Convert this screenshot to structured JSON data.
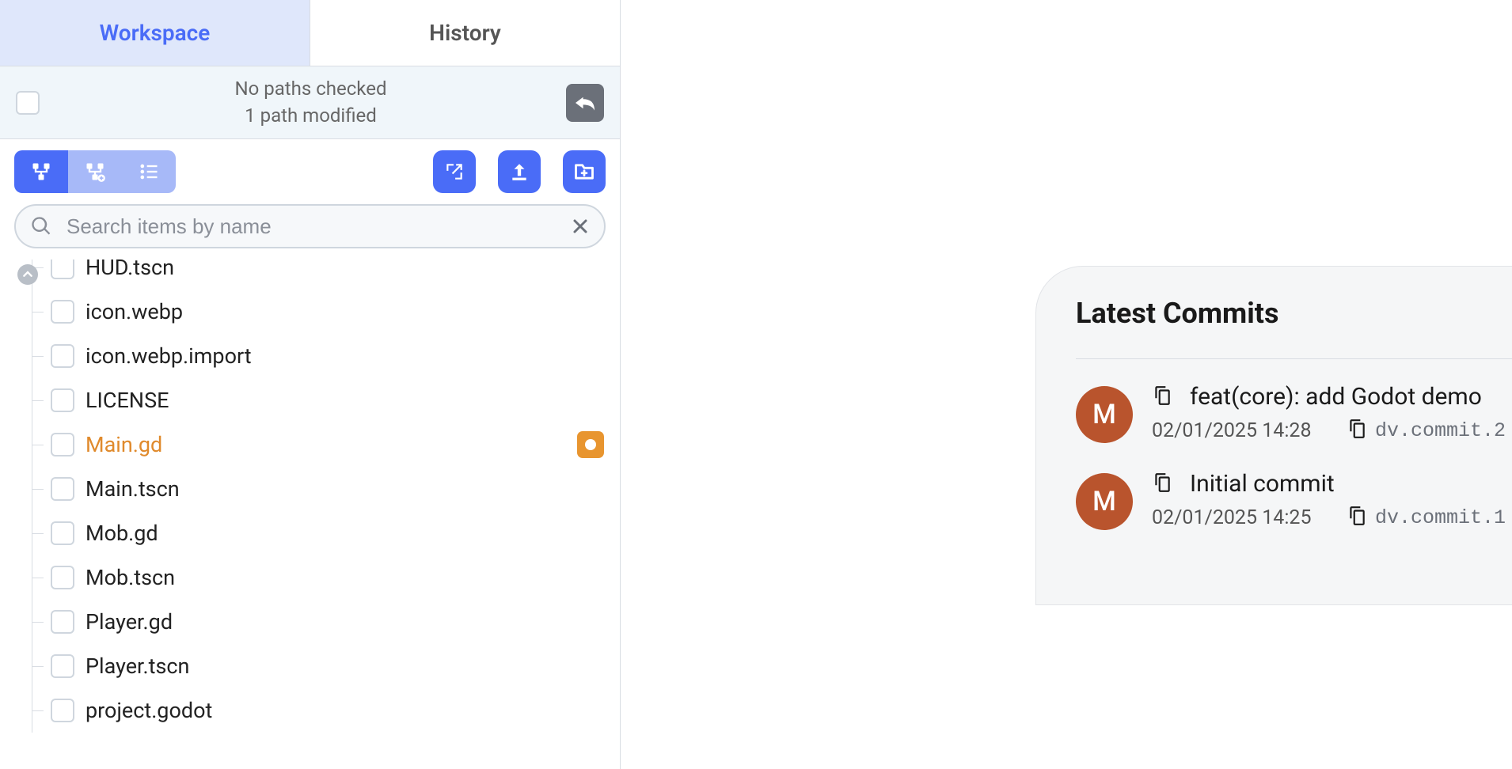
{
  "tabs": {
    "workspace": "Workspace",
    "history": "History"
  },
  "status": {
    "line1": "No paths checked",
    "line2": "1 path modified"
  },
  "search": {
    "placeholder": "Search items by name"
  },
  "files": [
    {
      "name": "HUD.tscn",
      "modified": false,
      "clipped": true
    },
    {
      "name": "icon.webp",
      "modified": false
    },
    {
      "name": "icon.webp.import",
      "modified": false
    },
    {
      "name": "LICENSE",
      "modified": false
    },
    {
      "name": "Main.gd",
      "modified": true
    },
    {
      "name": "Main.tscn",
      "modified": false
    },
    {
      "name": "Mob.gd",
      "modified": false
    },
    {
      "name": "Mob.tscn",
      "modified": false
    },
    {
      "name": "Player.gd",
      "modified": false
    },
    {
      "name": "Player.tscn",
      "modified": false
    },
    {
      "name": "project.godot",
      "modified": false
    }
  ],
  "commits_panel": {
    "title": "Latest Commits",
    "items": [
      {
        "avatar": "M",
        "message": "feat(core): add Godot demo",
        "date": "02/01/2025 14:28",
        "hash": "dv.commit.2"
      },
      {
        "avatar": "M",
        "message": "Initial commit",
        "date": "02/01/2025 14:25",
        "hash": "dv.commit.1"
      }
    ]
  }
}
